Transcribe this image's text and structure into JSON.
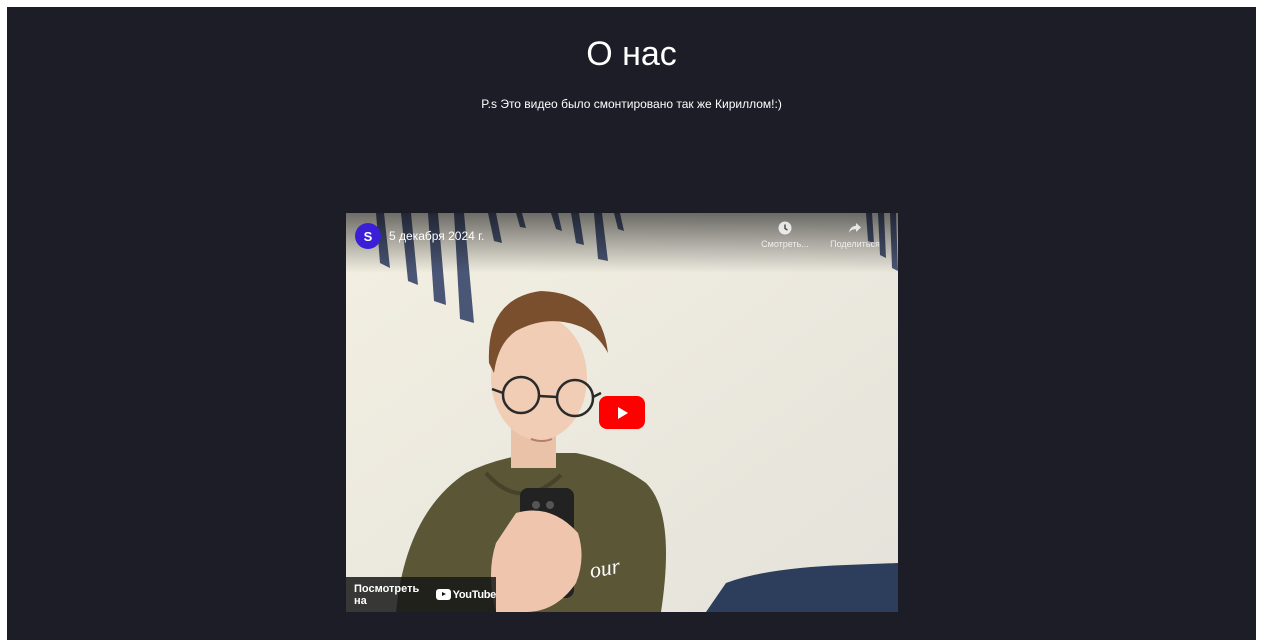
{
  "page": {
    "title": "О нас",
    "subtitle": "P.s Это видео было смонтировано так же Кириллом!:)"
  },
  "video": {
    "date": "5 декабря 2024 г.",
    "channel_avatar_icon": "channel-avatar-icon",
    "actions": {
      "watch_later": "Смотреть...",
      "share": "Поделиться"
    },
    "watch_on": "Посмотреть на",
    "youtube_logo_text": "YouTube",
    "colors": {
      "play_button": "#ff0000",
      "background": "#1d1d27",
      "avatar": "#3b1fd6"
    }
  }
}
